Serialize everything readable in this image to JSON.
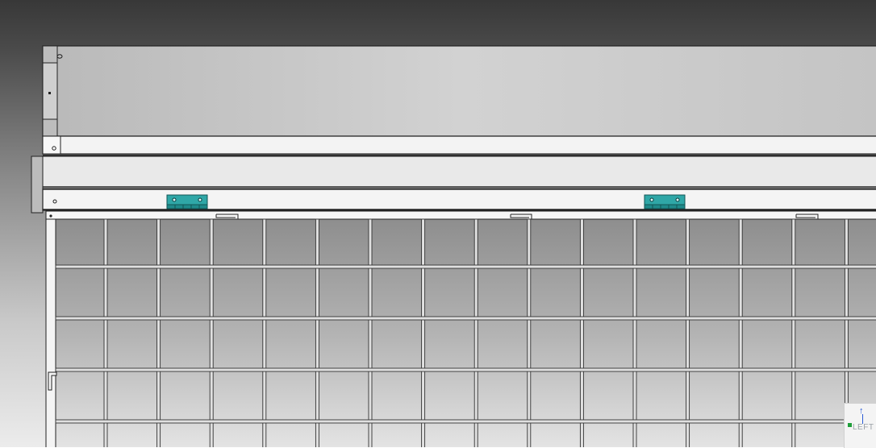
{
  "viewport": {
    "background": "gradient-dark-top-light-bottom",
    "part_colors": {
      "sheet": "#c8c8c8",
      "rail": "#f2f2f2",
      "hinge": "#2fa7a7",
      "mesh_wire": "#e0e0e0",
      "outline": "#222222"
    }
  },
  "model": {
    "mesh": {
      "columns": 16,
      "rows": 5
    },
    "hinges": 2,
    "clips": 3
  },
  "triad": {
    "label": "LEFT",
    "arrow_icon": "up-arrow-icon"
  }
}
